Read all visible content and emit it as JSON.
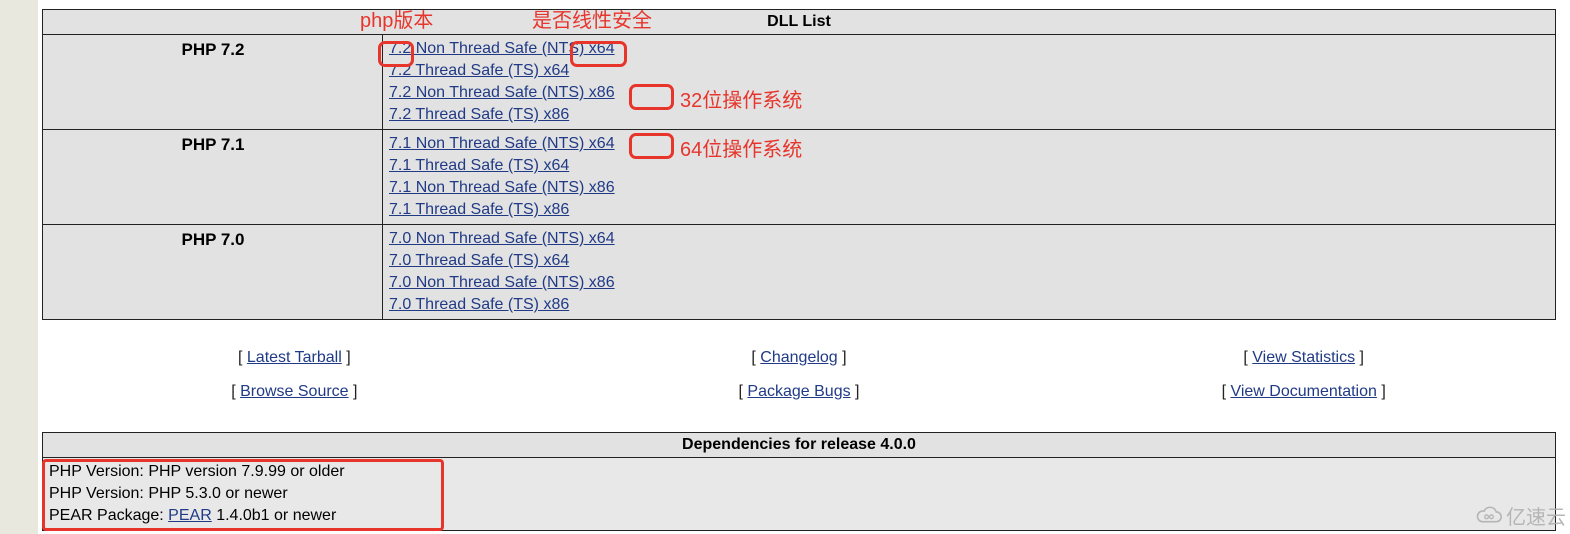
{
  "table": {
    "header": "DLL List",
    "rows": [
      {
        "version": "PHP 7.2",
        "links": [
          "7.2 Non Thread Safe (NTS) x64",
          "7.2 Thread Safe (TS) x64",
          "7.2 Non Thread Safe (NTS) x86",
          "7.2 Thread Safe (TS) x86"
        ]
      },
      {
        "version": "PHP 7.1",
        "links": [
          "7.1 Non Thread Safe (NTS) x64",
          "7.1 Thread Safe (TS) x64",
          "7.1 Non Thread Safe (NTS) x86",
          "7.1 Thread Safe (TS) x86"
        ]
      },
      {
        "version": "PHP 7.0",
        "links": [
          "7.0 Non Thread Safe (NTS) x64",
          "7.0 Thread Safe (TS) x64",
          "7.0 Non Thread Safe (NTS) x86",
          "7.0 Thread Safe (TS) x86"
        ]
      }
    ]
  },
  "annotations": {
    "php_version": "php版本",
    "thread_safe": "是否线性安全",
    "os_32": "32位操作系统",
    "os_64": "64位操作系统"
  },
  "bottom_links": {
    "latest_tarball": "Latest Tarball",
    "changelog": "Changelog",
    "view_statistics": "View Statistics",
    "browse_source": "Browse Source",
    "package_bugs": "Package Bugs",
    "view_documentation": "View Documentation"
  },
  "dependencies": {
    "header": "Dependencies for release 4.0.0",
    "line1": "PHP Version: PHP version 7.9.99 or older",
    "line2": "PHP Version: PHP 5.3.0 or newer",
    "line3_prefix": "PEAR Package: ",
    "line3_link": "PEAR",
    "line3_suffix": " 1.4.0b1 or newer"
  },
  "watermark": "亿速云"
}
